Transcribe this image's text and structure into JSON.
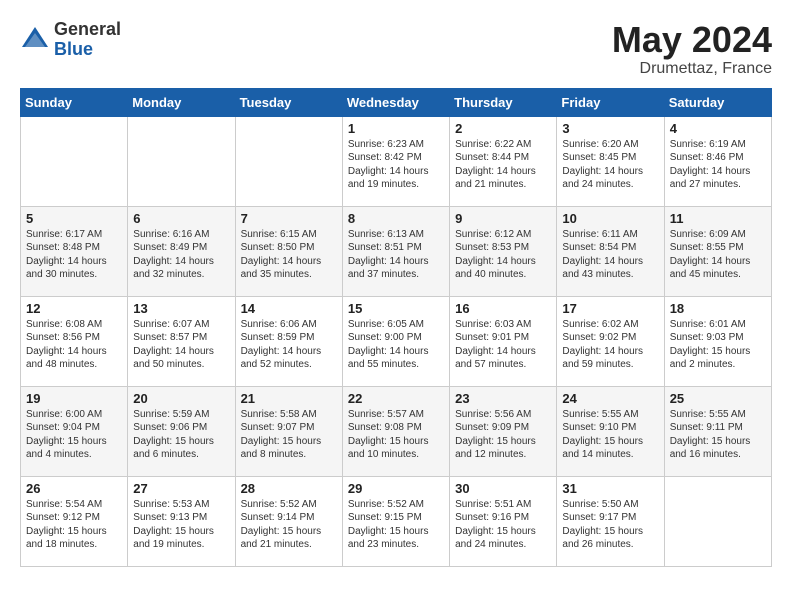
{
  "header": {
    "logo_general": "General",
    "logo_blue": "Blue",
    "month": "May 2024",
    "location": "Drumettaz, France"
  },
  "weekdays": [
    "Sunday",
    "Monday",
    "Tuesday",
    "Wednesday",
    "Thursday",
    "Friday",
    "Saturday"
  ],
  "weeks": [
    [
      {
        "day": "",
        "content": ""
      },
      {
        "day": "",
        "content": ""
      },
      {
        "day": "",
        "content": ""
      },
      {
        "day": "1",
        "content": "Sunrise: 6:23 AM\nSunset: 8:42 PM\nDaylight: 14 hours\nand 19 minutes."
      },
      {
        "day": "2",
        "content": "Sunrise: 6:22 AM\nSunset: 8:44 PM\nDaylight: 14 hours\nand 21 minutes."
      },
      {
        "day": "3",
        "content": "Sunrise: 6:20 AM\nSunset: 8:45 PM\nDaylight: 14 hours\nand 24 minutes."
      },
      {
        "day": "4",
        "content": "Sunrise: 6:19 AM\nSunset: 8:46 PM\nDaylight: 14 hours\nand 27 minutes."
      }
    ],
    [
      {
        "day": "5",
        "content": "Sunrise: 6:17 AM\nSunset: 8:48 PM\nDaylight: 14 hours\nand 30 minutes."
      },
      {
        "day": "6",
        "content": "Sunrise: 6:16 AM\nSunset: 8:49 PM\nDaylight: 14 hours\nand 32 minutes."
      },
      {
        "day": "7",
        "content": "Sunrise: 6:15 AM\nSunset: 8:50 PM\nDaylight: 14 hours\nand 35 minutes."
      },
      {
        "day": "8",
        "content": "Sunrise: 6:13 AM\nSunset: 8:51 PM\nDaylight: 14 hours\nand 37 minutes."
      },
      {
        "day": "9",
        "content": "Sunrise: 6:12 AM\nSunset: 8:53 PM\nDaylight: 14 hours\nand 40 minutes."
      },
      {
        "day": "10",
        "content": "Sunrise: 6:11 AM\nSunset: 8:54 PM\nDaylight: 14 hours\nand 43 minutes."
      },
      {
        "day": "11",
        "content": "Sunrise: 6:09 AM\nSunset: 8:55 PM\nDaylight: 14 hours\nand 45 minutes."
      }
    ],
    [
      {
        "day": "12",
        "content": "Sunrise: 6:08 AM\nSunset: 8:56 PM\nDaylight: 14 hours\nand 48 minutes."
      },
      {
        "day": "13",
        "content": "Sunrise: 6:07 AM\nSunset: 8:57 PM\nDaylight: 14 hours\nand 50 minutes."
      },
      {
        "day": "14",
        "content": "Sunrise: 6:06 AM\nSunset: 8:59 PM\nDaylight: 14 hours\nand 52 minutes."
      },
      {
        "day": "15",
        "content": "Sunrise: 6:05 AM\nSunset: 9:00 PM\nDaylight: 14 hours\nand 55 minutes."
      },
      {
        "day": "16",
        "content": "Sunrise: 6:03 AM\nSunset: 9:01 PM\nDaylight: 14 hours\nand 57 minutes."
      },
      {
        "day": "17",
        "content": "Sunrise: 6:02 AM\nSunset: 9:02 PM\nDaylight: 14 hours\nand 59 minutes."
      },
      {
        "day": "18",
        "content": "Sunrise: 6:01 AM\nSunset: 9:03 PM\nDaylight: 15 hours\nand 2 minutes."
      }
    ],
    [
      {
        "day": "19",
        "content": "Sunrise: 6:00 AM\nSunset: 9:04 PM\nDaylight: 15 hours\nand 4 minutes."
      },
      {
        "day": "20",
        "content": "Sunrise: 5:59 AM\nSunset: 9:06 PM\nDaylight: 15 hours\nand 6 minutes."
      },
      {
        "day": "21",
        "content": "Sunrise: 5:58 AM\nSunset: 9:07 PM\nDaylight: 15 hours\nand 8 minutes."
      },
      {
        "day": "22",
        "content": "Sunrise: 5:57 AM\nSunset: 9:08 PM\nDaylight: 15 hours\nand 10 minutes."
      },
      {
        "day": "23",
        "content": "Sunrise: 5:56 AM\nSunset: 9:09 PM\nDaylight: 15 hours\nand 12 minutes."
      },
      {
        "day": "24",
        "content": "Sunrise: 5:55 AM\nSunset: 9:10 PM\nDaylight: 15 hours\nand 14 minutes."
      },
      {
        "day": "25",
        "content": "Sunrise: 5:55 AM\nSunset: 9:11 PM\nDaylight: 15 hours\nand 16 minutes."
      }
    ],
    [
      {
        "day": "26",
        "content": "Sunrise: 5:54 AM\nSunset: 9:12 PM\nDaylight: 15 hours\nand 18 minutes."
      },
      {
        "day": "27",
        "content": "Sunrise: 5:53 AM\nSunset: 9:13 PM\nDaylight: 15 hours\nand 19 minutes."
      },
      {
        "day": "28",
        "content": "Sunrise: 5:52 AM\nSunset: 9:14 PM\nDaylight: 15 hours\nand 21 minutes."
      },
      {
        "day": "29",
        "content": "Sunrise: 5:52 AM\nSunset: 9:15 PM\nDaylight: 15 hours\nand 23 minutes."
      },
      {
        "day": "30",
        "content": "Sunrise: 5:51 AM\nSunset: 9:16 PM\nDaylight: 15 hours\nand 24 minutes."
      },
      {
        "day": "31",
        "content": "Sunrise: 5:50 AM\nSunset: 9:17 PM\nDaylight: 15 hours\nand 26 minutes."
      },
      {
        "day": "",
        "content": ""
      }
    ]
  ]
}
